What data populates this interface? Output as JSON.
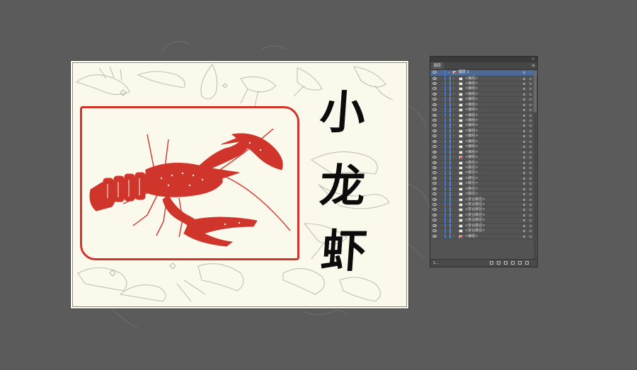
{
  "artwork": {
    "title_chars": [
      "小",
      "龙",
      "虾"
    ],
    "accent_color": "#d0352c",
    "paper_color": "#fbf8ec"
  },
  "layers_panel": {
    "tab_label": "图层",
    "collapse_label": "«",
    "menu_label": "≡",
    "top_layer_name": "图层 1",
    "rows": [
      {
        "name": "<编组>",
        "expand": true,
        "red": false
      },
      {
        "name": "<编组>",
        "expand": true,
        "red": false
      },
      {
        "name": "<编组>",
        "expand": true,
        "red": false
      },
      {
        "name": "<编组>",
        "expand": true,
        "red": false
      },
      {
        "name": "<编组>",
        "expand": true,
        "red": false
      },
      {
        "name": "<编组>",
        "expand": true,
        "red": false
      },
      {
        "name": "<编组>",
        "expand": true,
        "red": false
      },
      {
        "name": "<编组>",
        "expand": true,
        "red": false
      },
      {
        "name": "<编组>",
        "expand": true,
        "red": false
      },
      {
        "name": "<编组>",
        "expand": true,
        "red": false
      },
      {
        "name": "<编组>",
        "expand": true,
        "red": false
      },
      {
        "name": "<编组>",
        "expand": true,
        "red": false
      },
      {
        "name": "<编组>",
        "expand": true,
        "red": false
      },
      {
        "name": "<编组>",
        "expand": true,
        "red": false
      },
      {
        "name": "<编组>",
        "expand": true,
        "red": false
      },
      {
        "name": "<编组>",
        "expand": true,
        "red": true
      },
      {
        "name": "<路径>",
        "expand": false,
        "red": false
      },
      {
        "name": "<路径>",
        "expand": false,
        "red": false
      },
      {
        "name": "<路径>",
        "expand": false,
        "red": false
      },
      {
        "name": "<路径>",
        "expand": false,
        "red": false
      },
      {
        "name": "<路径>",
        "expand": false,
        "red": false
      },
      {
        "name": "<路径>",
        "expand": false,
        "red": false
      },
      {
        "name": "<路径>",
        "expand": false,
        "red": false
      },
      {
        "name": "<复合路径>",
        "expand": false,
        "red": false
      },
      {
        "name": "<复合路径>",
        "expand": false,
        "red": false
      },
      {
        "name": "<复合路径>",
        "expand": false,
        "red": false
      },
      {
        "name": "<复合路径>",
        "expand": false,
        "red": false
      },
      {
        "name": "<复合路径>",
        "expand": false,
        "red": false
      },
      {
        "name": "<复合路径>",
        "expand": false,
        "red": false
      },
      {
        "name": "<复合路径>",
        "expand": false,
        "red": false
      },
      {
        "name": "<编组>",
        "expand": true,
        "red": true
      }
    ],
    "footer_count": "1..."
  }
}
